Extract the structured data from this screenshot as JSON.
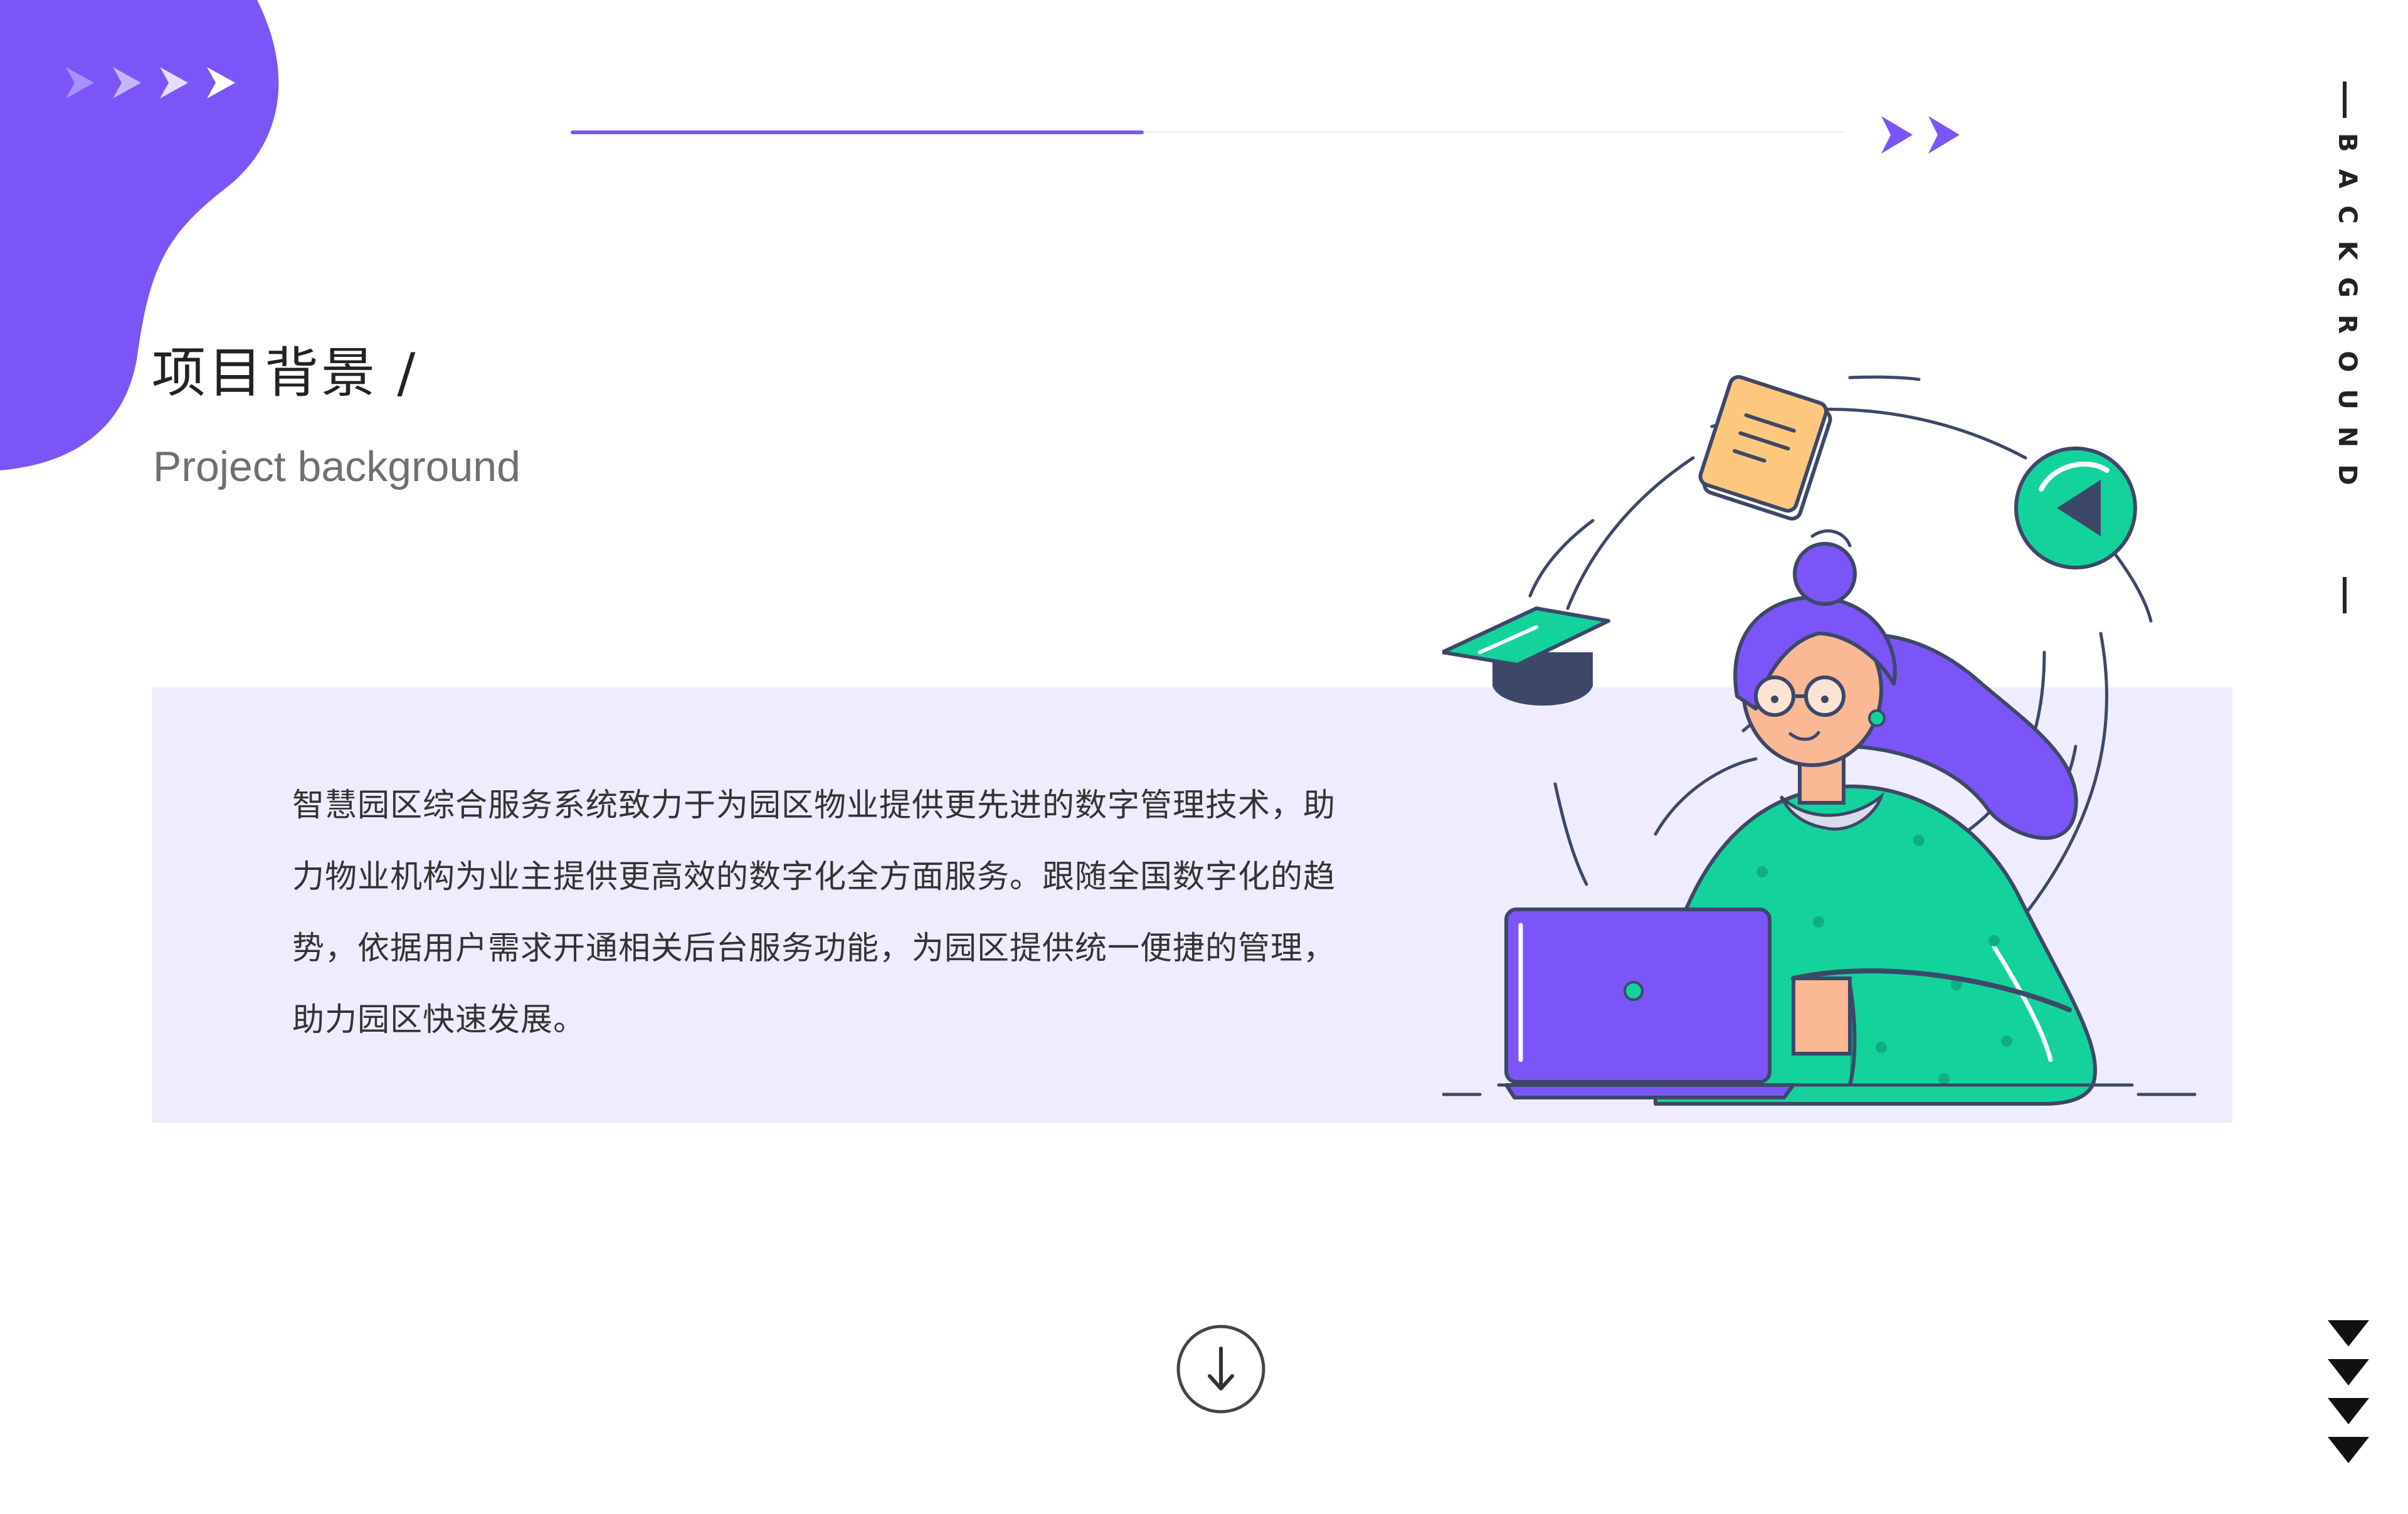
{
  "theme": {
    "accent": "#7b55f8",
    "accent_light": "#efecfd",
    "teal": "#14d29c",
    "text_dark": "#222222",
    "text_muted": "#6f6f6f"
  },
  "header": {
    "progress_percent": 45
  },
  "section": {
    "title_cn": "项目背景 /",
    "title_en": "Project background",
    "side_label": "BACKGROUND"
  },
  "content": {
    "paragraph": "智慧园区综合服务系统致力于为园区物业提供更先进的数字管理技术，助力物业机构为业主提供更高效的数字化全方面服务。跟随全国数字化的趋势，依据用户需求开通相关后台服务功能，为园区提供统一便捷的管理，助力园区快速发展。"
  },
  "icons": {
    "top_arrows": "chevron-right-icon",
    "scroll_down": "arrow-down-circle-icon",
    "side_chevrons": "chevron-down-icon"
  }
}
